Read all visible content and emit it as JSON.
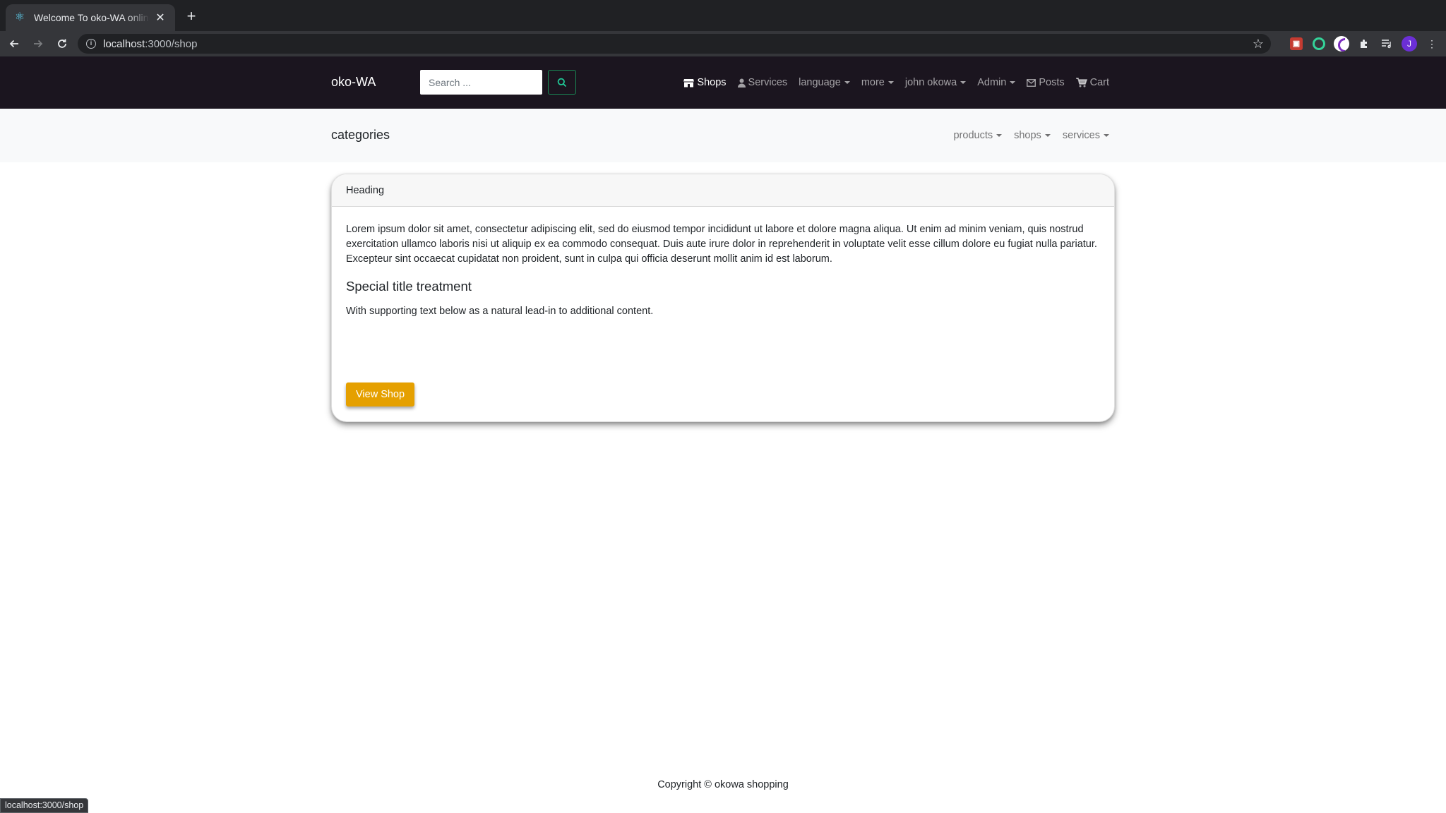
{
  "browser": {
    "tab_title": "Welcome To oko-WA online Store",
    "tab_close": "✕",
    "new_tab": "+",
    "url_host": "localhost",
    "url_path": ":3000/shop",
    "avatar_letter": "J",
    "status_url": "localhost:3000/shop"
  },
  "navbar": {
    "brand": "oko-WA",
    "search_placeholder": "Search ...",
    "links": {
      "shops": "Shops",
      "services": "Services",
      "language": "language",
      "more": "more",
      "user": "john okowa",
      "admin": "Admin",
      "posts": "Posts",
      "cart": "Cart"
    }
  },
  "categories": {
    "title": "categories",
    "links": {
      "products": "products",
      "shops": "shops",
      "services": "services"
    }
  },
  "card": {
    "header": "Heading",
    "text": "Lorem ipsum dolor sit amet, consectetur adipiscing elit, sed do eiusmod tempor incididunt ut labore et dolore magna aliqua. Ut enim ad minim veniam, quis nostrud exercitation ullamco laboris nisi ut aliquip ex ea commodo consequat. Duis aute irure dolor in reprehenderit in voluptate velit esse cillum dolore eu fugiat nulla pariatur. Excepteur sint occaecat cupidatat non proident, sunt in culpa qui officia deserunt mollit anim id est laborum.",
    "title": "Special title treatment",
    "subtext": "With supporting text below as a natural lead-in to additional content.",
    "button": "View Shop"
  },
  "footer": {
    "copyright": "Copyright © okowa shopping"
  },
  "colors": {
    "navbar_bg": "#1b151f",
    "accent_button": "#e5a000",
    "search_button_border": "#198754"
  },
  "icons": [
    "react-favicon",
    "back-arrow-icon",
    "forward-arrow-icon",
    "reload-icon",
    "info-icon",
    "star-icon",
    "extension-icons",
    "search-icon",
    "store-icon",
    "user-icon",
    "envelope-icon",
    "cart-icon"
  ]
}
